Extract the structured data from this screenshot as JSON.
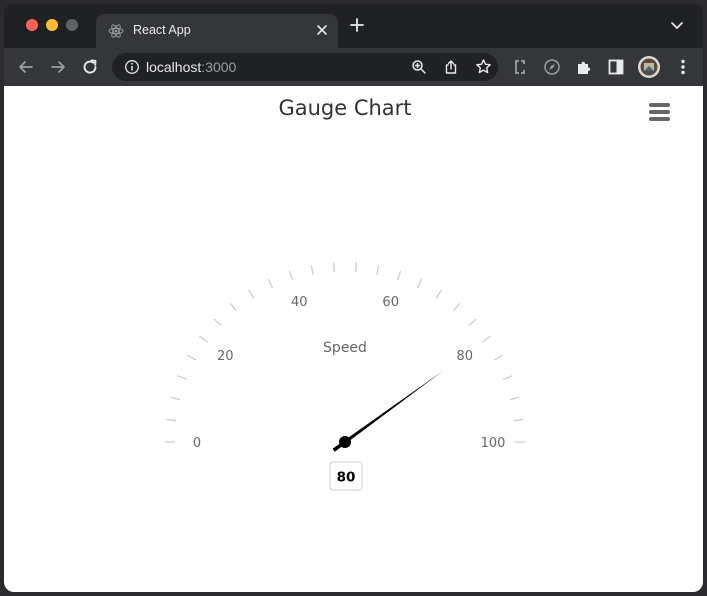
{
  "browser": {
    "tab_title": "React App",
    "url_host": "localhost",
    "url_port": ":3000",
    "colors": {
      "frame": "#202124",
      "toolbar": "#35363a",
      "close": "#ff5f57",
      "minimize": "#febc2e",
      "maximize": "#5f6368"
    }
  },
  "chart_data": {
    "type": "gauge",
    "title": "Gauge Chart",
    "series_name": "Speed",
    "value": 80,
    "value_label": "80",
    "range": [
      0,
      100
    ],
    "tick_labels": [
      "0",
      "20",
      "40",
      "60",
      "80",
      "100"
    ],
    "start_angle_deg": -90,
    "end_angle_deg": 90,
    "tick_color": "#cccccc",
    "needle_color": "#000000",
    "grid": false
  },
  "icons": {
    "tab": "react-logo-icon",
    "close_tab": "close-icon",
    "new_tab": "plus-icon",
    "tab_search": "chevron-down-icon",
    "back": "arrow-left-icon",
    "forward": "arrow-right-icon",
    "reload": "reload-icon",
    "site_info": "info-icon",
    "zoom": "zoom-icon",
    "share": "share-icon",
    "bookmark": "star-icon",
    "extensions": [
      "css-extension-icon",
      "compass-extension-icon",
      "puzzle-icon"
    ],
    "sidebar": "sidebar-icon",
    "profile": "avatar",
    "menu": "kebab-menu-icon",
    "chart_menu": "hamburger-menu-icon"
  }
}
